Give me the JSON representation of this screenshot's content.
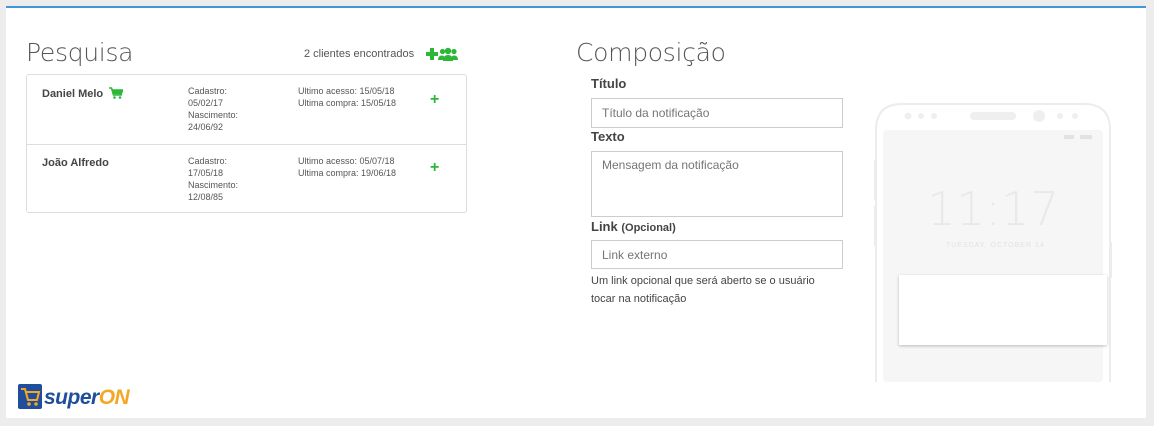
{
  "search": {
    "title": "Pesquisa",
    "count_text": "2 clientes encontrados",
    "clients": [
      {
        "name": "Daniel Melo",
        "cadastro_label": "Cadastro:",
        "cadastro": "05/02/17",
        "nascimento_label": "Nascimento:",
        "nascimento": "24/06/92",
        "ultimo_acesso": "Ultimo acesso: 15/05/18",
        "ultima_compra": "Ultima compra: 15/05/18",
        "has_cart": true
      },
      {
        "name": "João Alfredo",
        "cadastro_label": "Cadastro:",
        "cadastro": "17/05/18",
        "nascimento_label": "Nascimento:",
        "nascimento": "12/08/85",
        "ultimo_acesso": "Ultimo acesso: 05/07/18",
        "ultima_compra": "Ultima compra: 19/06/18",
        "has_cart": false
      }
    ]
  },
  "composition": {
    "title": "Composição",
    "titulo_label": "Título",
    "titulo_placeholder": "Título da notificação",
    "texto_label": "Texto",
    "texto_placeholder": "Mensagem da notificação",
    "link_label": "Link",
    "link_optional": "(Opcional)",
    "link_placeholder": "Link externo",
    "link_help": "Um link opcional que será aberto se o usuário tocar na notificação"
  },
  "phone_preview": {
    "time": "11:17",
    "date": "TUESDAY, OCTOBER 14"
  },
  "brand": {
    "super": "super",
    "on": "ON"
  },
  "colors": {
    "accent": "#3f97d4",
    "green": "#2db739",
    "brand_blue": "#1f4f9c",
    "brand_orange": "#f5a623"
  },
  "icons": [
    "add-icon",
    "users-icon",
    "cart-icon",
    "superon-logo"
  ]
}
